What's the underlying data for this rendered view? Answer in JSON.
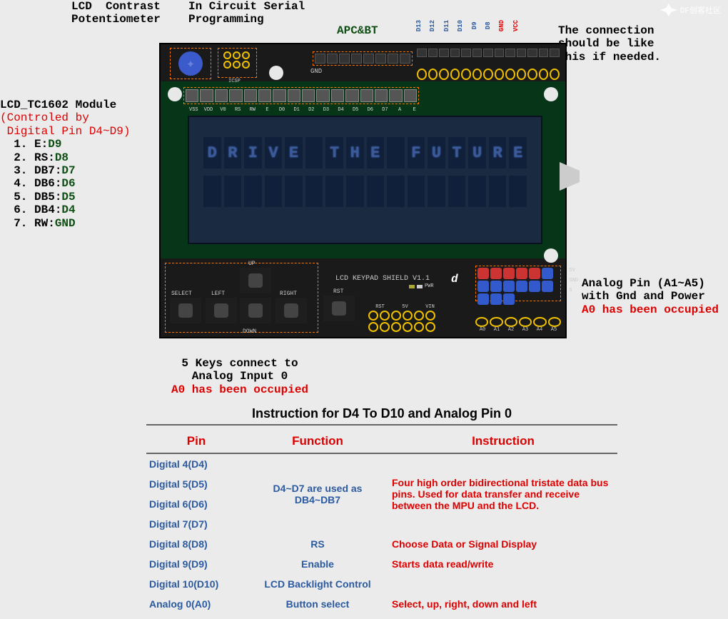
{
  "corner_brand": "DF创客社区",
  "top_labels": {
    "contrast": "LCD  Contrast\nPotentiometer",
    "icsp": "In Circuit Serial\nProgramming",
    "apcbt": "APC&BT",
    "dpins": [
      "D13",
      "D12",
      "D11",
      "D10",
      "D9",
      "D8",
      "GND",
      "VCC"
    ],
    "conn_note": "The connection\nshould be like\nthis if needed."
  },
  "left_module": {
    "title": "LCD_TC1602 Module",
    "control": "(Controled by\n Digital Pin D4~D9)",
    "lines": [
      {
        "n": "1.",
        "name": "E:",
        "pin": "D9"
      },
      {
        "n": "2.",
        "name": "RS:",
        "pin": "D8"
      },
      {
        "n": "3.",
        "name": "DB7:",
        "pin": "D7"
      },
      {
        "n": "4.",
        "name": "DB6:",
        "pin": "D6"
      },
      {
        "n": "5.",
        "name": "DB5:",
        "pin": "D5"
      },
      {
        "n": "6.",
        "name": "DB4:",
        "pin": "D4"
      },
      {
        "n": "7.",
        "name": "RW:",
        "pin": "GND"
      }
    ]
  },
  "lcd": {
    "row1": "DRIVE THE FUTURE",
    "header_labels": [
      "VSS",
      "VDD",
      "V0",
      "RS",
      "RW",
      "E",
      "D0",
      "D1",
      "D2",
      "D3",
      "D4",
      "D5",
      "D6",
      "D7",
      "A",
      "E"
    ]
  },
  "board": {
    "gnd": "GND",
    "icsp": "ICSP",
    "title": "LCD KEYPAD SHIELD V1.1",
    "pwr": "PWR",
    "buttons": {
      "up": "UP",
      "down": "DOWN",
      "left": "LEFT",
      "right": "RIGHT",
      "select": "SELECT",
      "rst": "RST"
    },
    "pwr_pins": [
      "RST",
      "5V",
      "VIN"
    ],
    "analog_lbls": [
      "A0",
      "A1",
      "A2",
      "A3",
      "A4",
      "A5"
    ],
    "side": [
      "5V",
      "GND",
      "S"
    ]
  },
  "right_notes": {
    "analog": "Analog Pin (A1~A5)\nwith Gnd and Power",
    "occupied": "A0 has been occupied"
  },
  "bottom_note": {
    "keys": "5 Keys connect to\nAnalog Input 0",
    "occupied": "A0 has been occupied"
  },
  "table": {
    "title": "Instruction for D4 To D10 and Analog Pin 0",
    "headers": [
      "Pin",
      "Function",
      "Instruction"
    ],
    "rows": [
      {
        "pin": "Digital  4(D4)",
        "func": "",
        "instr": ""
      },
      {
        "pin": "Digital  5(D5)",
        "func": "D4~D7 are used as\nDB4~DB7",
        "instr": "Four high order bidirectional tristate data bus pins. Used for data transfer and receive between the MPU and the LCD."
      },
      {
        "pin": "Digital  6(D6)",
        "func": "",
        "instr": ""
      },
      {
        "pin": "Digital  7(D7)",
        "func": "",
        "instr": ""
      },
      {
        "pin": "Digital  8(D8)",
        "func": "RS",
        "instr": "Choose Data or Signal Display"
      },
      {
        "pin": "Digital  9(D9)",
        "func": "Enable",
        "instr": "Starts data read/write"
      },
      {
        "pin": "Digital 10(D10)",
        "func": "LCD Backlight Control",
        "instr": ""
      },
      {
        "pin": "Analog  0(A0)",
        "func": "Button select",
        "instr": "Select, up, right, down and left"
      }
    ]
  }
}
